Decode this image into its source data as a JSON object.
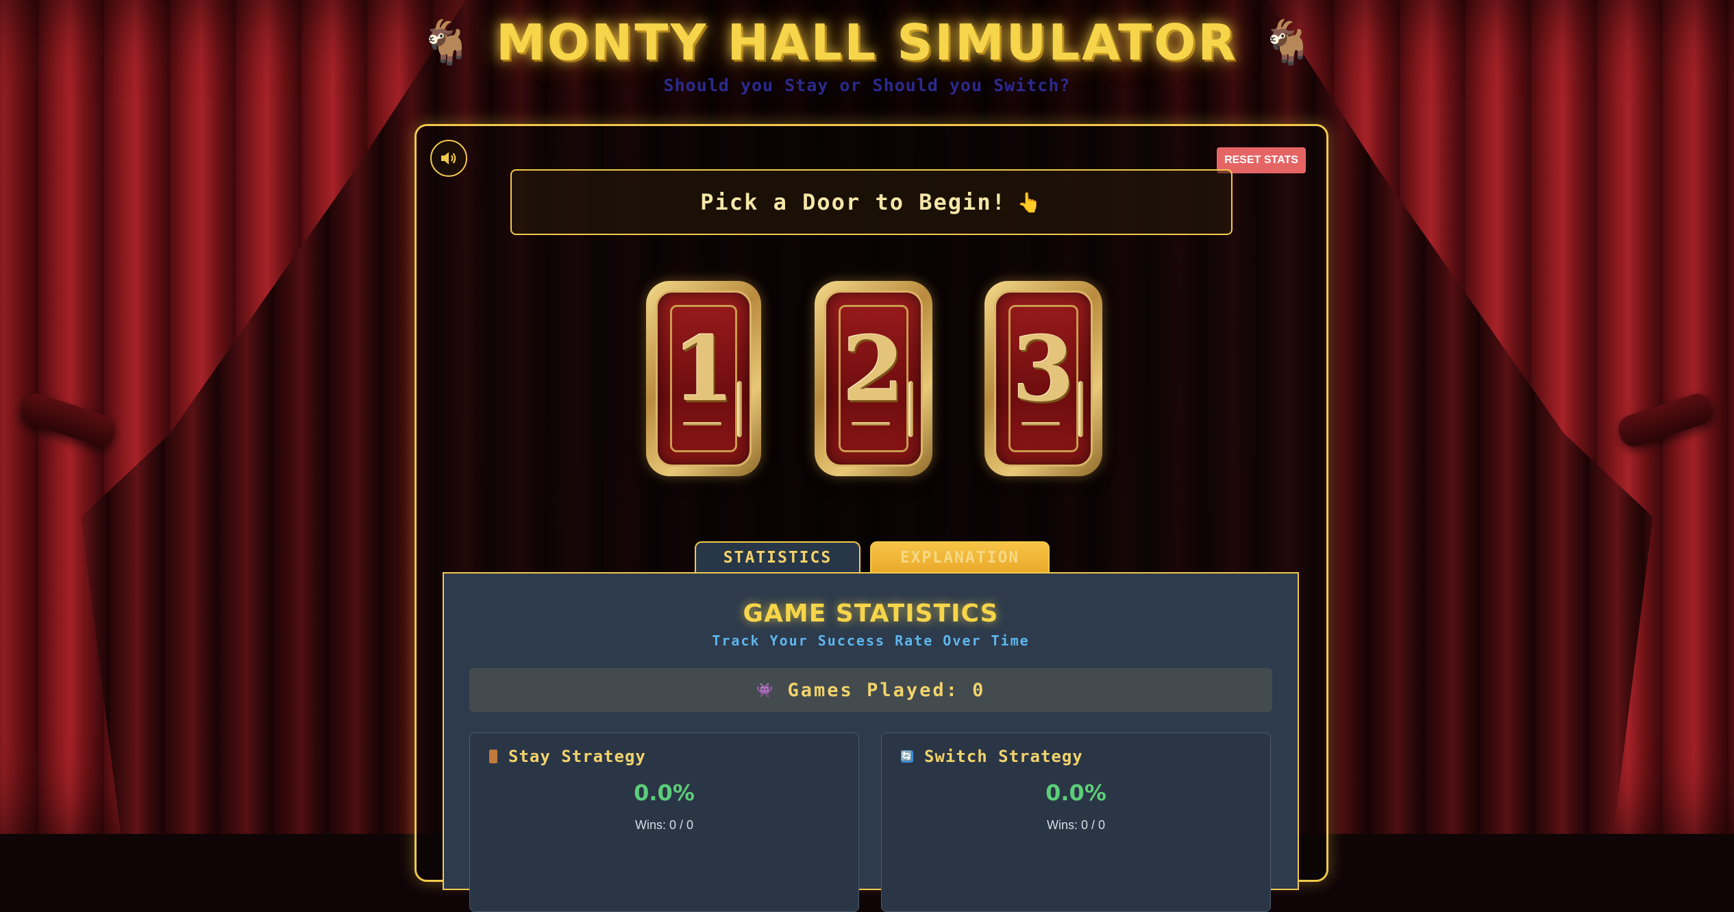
{
  "header": {
    "title": "MONTY HALL SIMULATOR",
    "goat_icon": "🐐",
    "subtitle": "Should you Stay or Should you Switch?"
  },
  "controls": {
    "sound_icon": "speaker-icon",
    "reset_label": "RESET STATS"
  },
  "message": {
    "text": "Pick a Door to Begin!",
    "icon": "👆"
  },
  "doors": [
    {
      "number": "1"
    },
    {
      "number": "2"
    },
    {
      "number": "3"
    }
  ],
  "tabs": {
    "statistics": "STATISTICS",
    "explanation": "EXPLANATION"
  },
  "stats": {
    "title": "GAME STATISTICS",
    "subtitle": "Track Your Success Rate Over Time",
    "games_played_icon": "👾",
    "games_played_label": "Games Played: 0",
    "stay": {
      "label": "Stay Strategy",
      "percent": "0.0%",
      "wins": "Wins: 0 / 0"
    },
    "switch": {
      "label": "Switch Strategy",
      "icon": "🔄",
      "percent": "0.0%",
      "wins": "Wins: 0 / 0"
    }
  },
  "colors": {
    "gold": "#f2c94c",
    "reset": "#e56565",
    "win_green": "#5cce79",
    "panel_blue": "#2d3b4c"
  }
}
